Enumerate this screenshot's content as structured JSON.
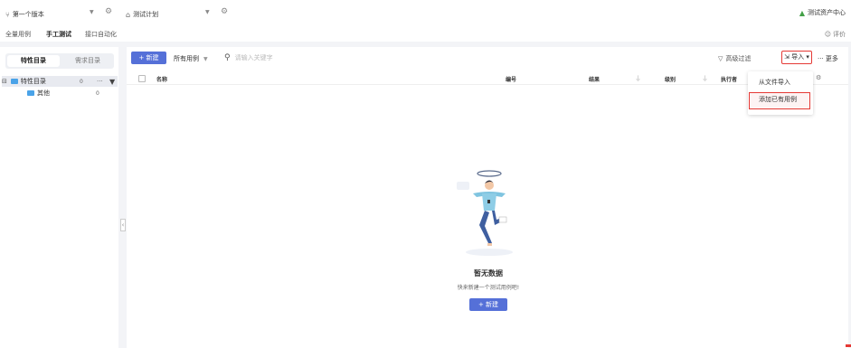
{
  "topbar": {
    "version": {
      "icon": "branch-icon",
      "label": "第一个版本"
    },
    "plan": {
      "icon": "home-icon",
      "label": "测试计划"
    },
    "asset_center": {
      "icon": "asset-icon",
      "label": "测试资产中心"
    }
  },
  "tabs": [
    {
      "label": "全量用例",
      "active": false
    },
    {
      "label": "手工测试",
      "active": true
    },
    {
      "label": "接口自动化",
      "active": false
    }
  ],
  "rate": {
    "icon": "smile-icon",
    "label": "评价"
  },
  "sidebar": {
    "segments": [
      {
        "label": "特性目录",
        "active": true
      },
      {
        "label": "需求目录",
        "active": false
      }
    ],
    "tree": [
      {
        "label": "特性目录",
        "count": "0",
        "selected": true
      },
      {
        "label": "其他",
        "count": "0",
        "selected": false
      }
    ]
  },
  "toolbar": {
    "new_label": "+ 新建",
    "filter_label": "所有用例",
    "search_placeholder": "请输入关键字",
    "advanced_filter": "高级过滤",
    "import_label": "导入",
    "more_label": "··· 更多"
  },
  "table": {
    "columns": [
      "名称",
      "编号",
      "结果",
      "级别",
      "执行者"
    ]
  },
  "import_menu": {
    "items": [
      "从文件导入",
      "添加已有用例"
    ]
  },
  "empty": {
    "title": "暂无数据",
    "subtitle": "快来新建一个测试用例吧!",
    "button": "+ 新建"
  },
  "colors": {
    "primary": "#5570d8",
    "highlight": "#e53935",
    "folder": "#4aa3e8",
    "page_bg": "#f3f4f7"
  }
}
